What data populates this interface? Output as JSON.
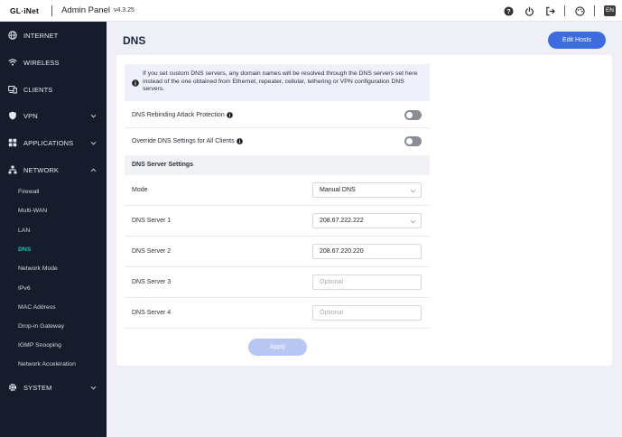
{
  "topbar": {
    "logo": "GL·iNet",
    "title": "Admin Panel",
    "version": "v4.3.25",
    "lang": "EN",
    "icons": [
      "help-icon",
      "power-icon",
      "logout-icon",
      "theme-icon"
    ]
  },
  "sidebar": {
    "items": [
      {
        "label": "INTERNET",
        "icon": "globe-icon"
      },
      {
        "label": "WIRELESS",
        "icon": "wifi-icon"
      },
      {
        "label": "CLIENTS",
        "icon": "devices-icon"
      },
      {
        "label": "VPN",
        "icon": "shield-icon"
      },
      {
        "label": "APPLICATIONS",
        "icon": "apps-icon"
      },
      {
        "label": "NETWORK",
        "icon": "network-icon"
      },
      {
        "label": "SYSTEM",
        "icon": "gear-icon"
      }
    ],
    "network_sub": [
      "Firewall",
      "Multi-WAN",
      "LAN",
      "DNS",
      "Network Mode",
      "IPv6",
      "MAC Address",
      "Drop-in Gateway",
      "IGMP Snooping",
      "Network Acceleration"
    ],
    "active_sub": "DNS",
    "accent": "#19c3b4"
  },
  "main": {
    "title": "DNS",
    "edit_hosts": "Edit Hosts",
    "info": "If you set custom DNS servers, any domain names will be resolved through the DNS servers set here instead of the one obtained from Ethernet, repeater, cellular, tethering or VPN configuration DNS servers.",
    "rebinding_label": "DNS Rebinding Attack Protection",
    "override_label": "Override DNS Settings for All Clients",
    "rebinding_on": false,
    "override_on": false,
    "section": "DNS Server Settings",
    "mode_label": "Mode",
    "mode_value": "Manual DNS",
    "dns1_label": "DNS Server 1",
    "dns1_value": "208.67.222.222",
    "dns2_label": "DNS Server 2",
    "dns2_value": "208.67.220.220",
    "dns3_label": "DNS Server 3",
    "dns4_label": "DNS Server 4",
    "placeholder": "Optional",
    "apply": "Apply",
    "button_color": "#3d6ce0"
  }
}
